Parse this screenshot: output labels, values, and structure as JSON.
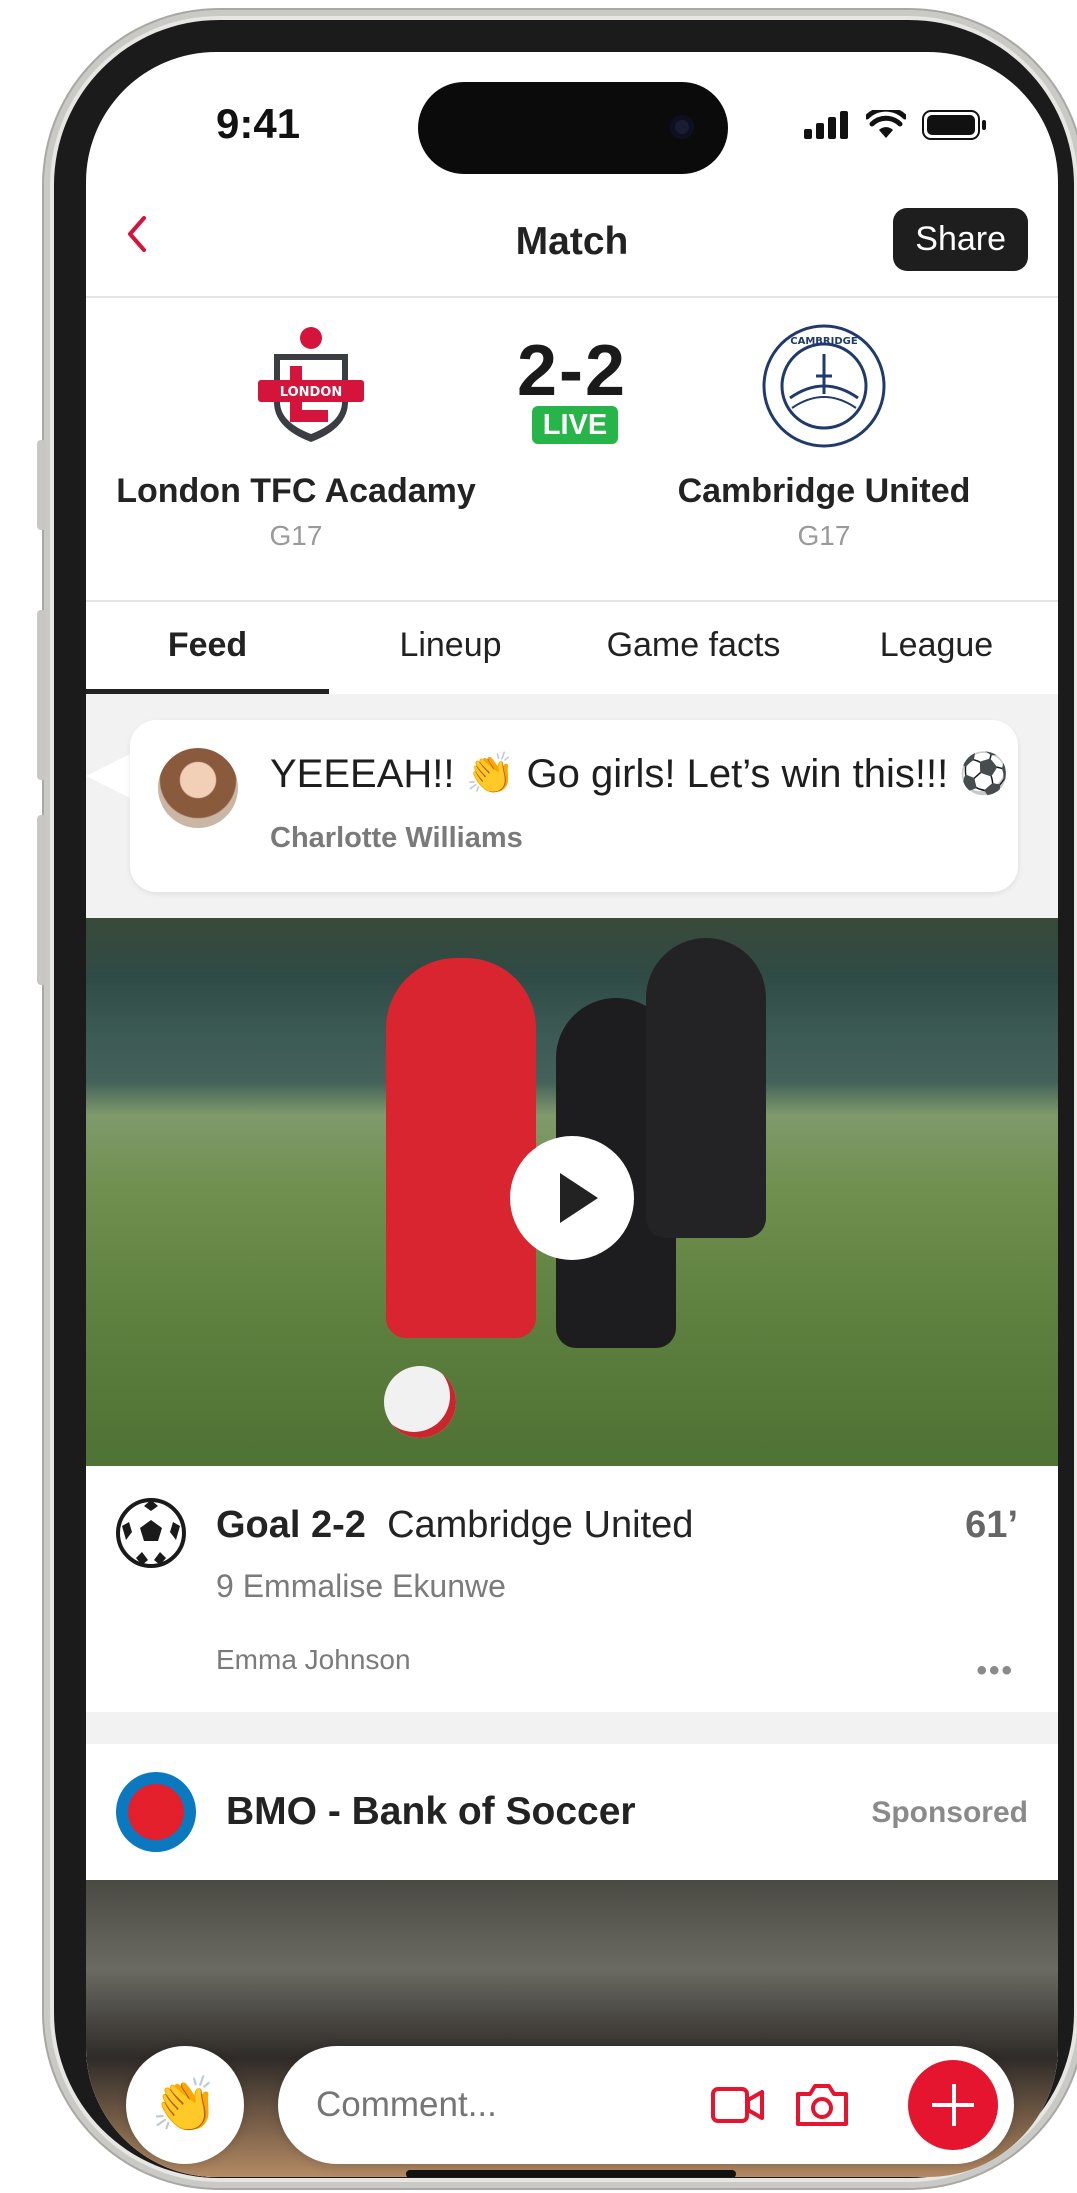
{
  "status_bar": {
    "time": "9:41"
  },
  "header": {
    "title": "Match",
    "share_label": "Share"
  },
  "match": {
    "score": "2-2",
    "status": "LIVE",
    "home": {
      "name": "London TFC Acadamy",
      "group": "G17",
      "crest_text": "LONDON"
    },
    "away": {
      "name": "Cambridge United",
      "group": "G17",
      "crest_text": "CAMBRIDGE"
    }
  },
  "tabs": [
    {
      "label": "Feed",
      "active": true
    },
    {
      "label": "Lineup",
      "active": false
    },
    {
      "label": "Game facts",
      "active": false
    },
    {
      "label": "League",
      "active": false
    }
  ],
  "feed": {
    "comment": {
      "text": "YEEEAH!! 👏 Go girls! Let’s win this!!! ⚽",
      "author": "Charlotte Williams"
    },
    "goal_event": {
      "label": "Goal 2-2",
      "team": "Cambridge United",
      "minute": "61’",
      "player": "9 Emmalise Ekunwe",
      "posted_by": "Emma Johnson",
      "more": "•••"
    },
    "sponsored": {
      "name": "BMO - Bank of Soccer",
      "tag": "Sponsored"
    }
  },
  "comment_bar": {
    "reaction": "👏",
    "placeholder": "Comment..."
  },
  "colors": {
    "accent": "#e5142f",
    "live": "#27b54a",
    "text": "#232323",
    "muted": "#8a8a8a"
  },
  "icons": [
    "back-chevron-icon",
    "signal-icon",
    "wifi-icon",
    "battery-icon",
    "play-icon",
    "soccer-ball-icon",
    "more-icon",
    "video-icon",
    "camera-icon",
    "plus-icon"
  ]
}
